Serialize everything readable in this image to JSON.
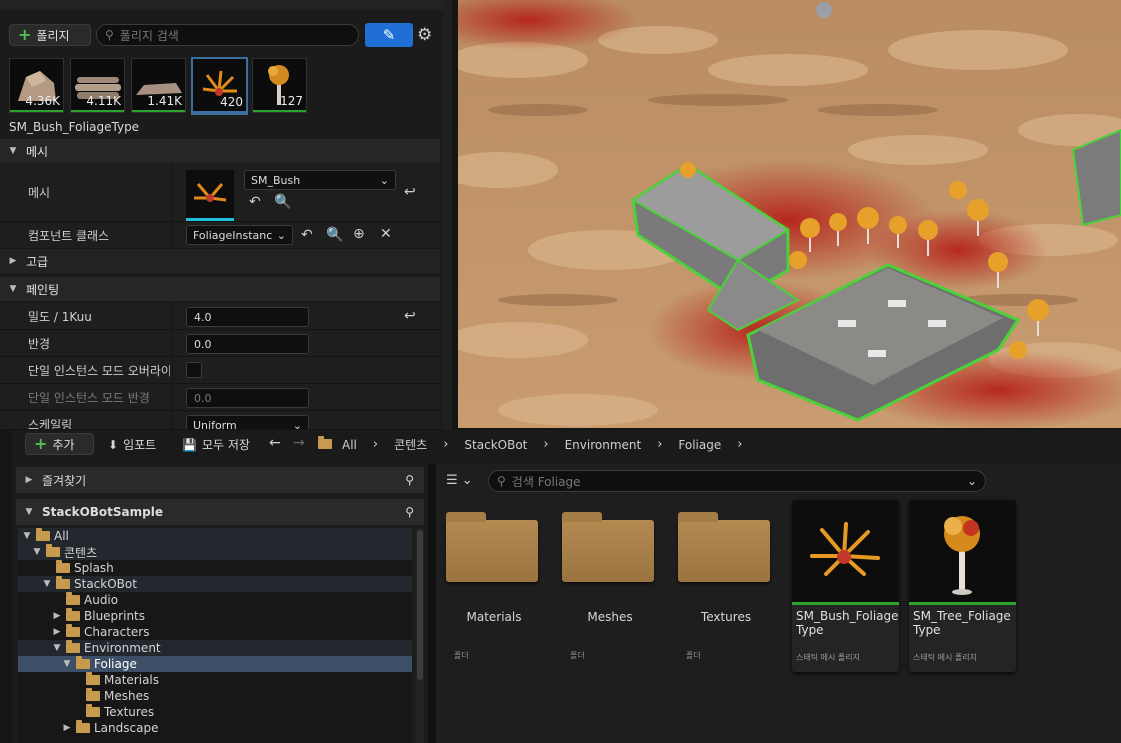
{
  "foliage": {
    "add_label": "폴리지",
    "search_placeholder": "폴리지 검색",
    "thumbnails": [
      {
        "count": "4.36K"
      },
      {
        "count": "4.11K"
      },
      {
        "count": "1.41K"
      },
      {
        "count": "420"
      },
      {
        "count": "127"
      }
    ],
    "selected_name": "SM_Bush_FoliageType",
    "sections": {
      "mesh": "메시",
      "advanced": "고급",
      "painting": "페인팅"
    },
    "mesh_row": {
      "label": "메시",
      "value": "SM_Bush"
    },
    "component_row": {
      "label": "컴포넌트 클래스",
      "value": "FoliageInstanc"
    },
    "painting_rows": [
      {
        "label": "밀도 / 1Kuu",
        "value": "4.0"
      },
      {
        "label": "반경",
        "value": "0.0"
      },
      {
        "label": "단일 인스턴스 모드 오버라이..."
      },
      {
        "label": "단일 인스턴스 모드 반경",
        "value": "0.0"
      },
      {
        "label": "스케일링",
        "value": "Uniform"
      }
    ]
  },
  "content_browser": {
    "add_label": "추가",
    "import_label": "임포트",
    "save_all_label": "모두 저장",
    "breadcrumbs": [
      "All",
      "콘텐츠",
      "StackOBot",
      "Environment",
      "Foliage"
    ],
    "favorites_label": "즐겨찾기",
    "project_label": "StackOBotSample",
    "search_placeholder": "검색 Foliage",
    "tree": [
      {
        "label": "All"
      },
      {
        "label": "콘텐츠"
      },
      {
        "label": "Splash"
      },
      {
        "label": "StackOBot"
      },
      {
        "label": "Audio"
      },
      {
        "label": "Blueprints"
      },
      {
        "label": "Characters"
      },
      {
        "label": "Environment"
      },
      {
        "label": "Foliage"
      },
      {
        "label": "Materials"
      },
      {
        "label": "Meshes"
      },
      {
        "label": "Textures"
      },
      {
        "label": "Landscape"
      }
    ],
    "folders": [
      {
        "name": "Materials",
        "type": "폴더"
      },
      {
        "name": "Meshes",
        "type": "폴더"
      },
      {
        "name": "Textures",
        "type": "폴더"
      }
    ],
    "assets": [
      {
        "name": "SM_Bush_Foliage Type",
        "type": "스태틱 메시 폴리지"
      },
      {
        "name": "SM_Tree_Foliage Type",
        "type": "스태틱 메시 폴리지"
      }
    ]
  },
  "colors": {
    "accent_blue": "#1f6fd6",
    "green_bar": "#2ca32c",
    "folder": "#c89a4d"
  }
}
